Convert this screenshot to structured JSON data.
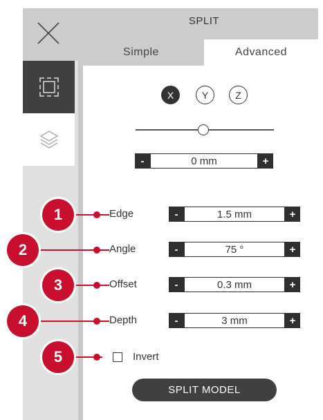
{
  "header": {
    "title": "SPLIT"
  },
  "tabs": [
    {
      "label": "Simple",
      "active": false
    },
    {
      "label": "Advanced",
      "active": true
    }
  ],
  "sidebar": {
    "items": [
      {
        "icon": "split-frame-icon",
        "active": true
      },
      {
        "icon": "layers-icon",
        "active": false
      }
    ]
  },
  "axes": [
    {
      "label": "X",
      "selected": true
    },
    {
      "label": "Y",
      "selected": false
    },
    {
      "label": "Z",
      "selected": false
    }
  ],
  "position": {
    "value": "0 mm",
    "minus": "-",
    "plus": "+",
    "slider_fraction": 0.5
  },
  "params": [
    {
      "callout": "1",
      "label": "Edge",
      "value": "1.5 mm",
      "minus": "-",
      "plus": "+"
    },
    {
      "callout": "2",
      "label": "Angle",
      "value": "75 °",
      "minus": "-",
      "plus": "+"
    },
    {
      "callout": "3",
      "label": "Offset",
      "value": "0.3 mm",
      "minus": "-",
      "plus": "+"
    },
    {
      "callout": "4",
      "label": "Depth",
      "value": "3 mm",
      "minus": "-",
      "plus": "+"
    }
  ],
  "invert": {
    "callout": "5",
    "label": "Invert",
    "checked": false
  },
  "split_button": {
    "label": "SPLIT MODEL"
  },
  "colors": {
    "callout": "#c8102e",
    "dark": "#2f2f2f",
    "panel": "#cccccc"
  }
}
